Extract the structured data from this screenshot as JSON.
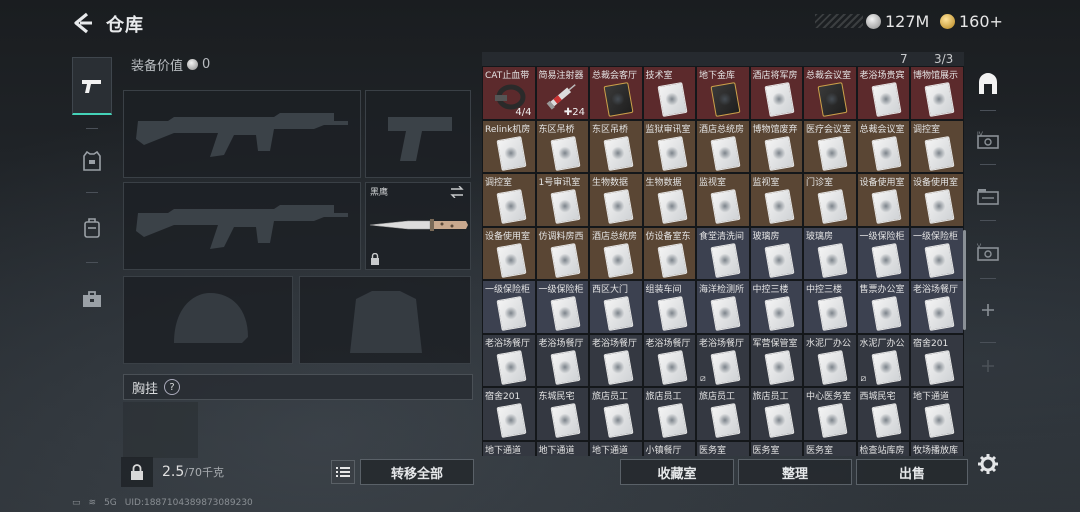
{
  "header": {
    "title": "仓库",
    "currency_silver": "127M",
    "currency_gold": "160+"
  },
  "equipment": {
    "value_label": "装备价值",
    "value": "0",
    "knife_label": "黑鹰",
    "chest_label": "胸挂",
    "chest_help": "?"
  },
  "footer": {
    "weight": "2.5",
    "weight_cap": "/70千克",
    "transfer_all": "转移全部",
    "collection_room": "收藏室",
    "organize": "整理",
    "sell": "出售"
  },
  "storage": {
    "header_counts": [
      "7",
      "3/3"
    ],
    "items": [
      {
        "name": "CAT止血带",
        "color": "r-red",
        "kind": "tourniquet",
        "stat": "4/4"
      },
      {
        "name": "简易注射器",
        "color": "r-red",
        "kind": "syringe",
        "stat": "✚24"
      },
      {
        "name": "总裁会客厅",
        "color": "r-red",
        "kind": "card-gold"
      },
      {
        "name": "技术室",
        "color": "r-red",
        "kind": "card"
      },
      {
        "name": "地下金库",
        "color": "r-red",
        "kind": "card-gold"
      },
      {
        "name": "酒店将军房",
        "color": "r-red",
        "kind": "card"
      },
      {
        "name": "总裁会议室",
        "color": "r-red",
        "kind": "card-gold"
      },
      {
        "name": "老浴场贵宾",
        "color": "r-red",
        "kind": "card"
      },
      {
        "name": "博物馆展示",
        "color": "r-red",
        "kind": "card"
      },
      {
        "name": "Relink机房",
        "color": "r-brown",
        "kind": "card"
      },
      {
        "name": "东区吊桥",
        "color": "r-brown",
        "kind": "card"
      },
      {
        "name": "东区吊桥",
        "color": "r-brown",
        "kind": "card"
      },
      {
        "name": "监狱审讯室",
        "color": "r-brown",
        "kind": "card"
      },
      {
        "name": "酒店总统房",
        "color": "r-brown",
        "kind": "card"
      },
      {
        "name": "博物馆废弃",
        "color": "r-brown",
        "kind": "card"
      },
      {
        "name": "医疗会议室",
        "color": "r-brown",
        "kind": "card"
      },
      {
        "name": "总裁会议室",
        "color": "r-brown",
        "kind": "card"
      },
      {
        "name": "调控室",
        "color": "r-brown",
        "kind": "card"
      },
      {
        "name": "调控室",
        "color": "r-brown",
        "kind": "card"
      },
      {
        "name": "1号审讯室",
        "color": "r-brown",
        "kind": "card"
      },
      {
        "name": "生物数据",
        "color": "r-brown",
        "kind": "card"
      },
      {
        "name": "生物数据",
        "color": "r-brown",
        "kind": "card"
      },
      {
        "name": "监视室",
        "color": "r-brown",
        "kind": "card"
      },
      {
        "name": "监视室",
        "color": "r-brown",
        "kind": "card"
      },
      {
        "name": "门诊室",
        "color": "r-brown",
        "kind": "card"
      },
      {
        "name": "设备使用室",
        "color": "r-brown",
        "kind": "card"
      },
      {
        "name": "设备使用室",
        "color": "r-brown",
        "kind": "card"
      },
      {
        "name": "设备使用室",
        "color": "r-brown",
        "kind": "card"
      },
      {
        "name": "仿调料房西",
        "color": "r-brown",
        "kind": "card"
      },
      {
        "name": "酒店总统房",
        "color": "r-brown",
        "kind": "card"
      },
      {
        "name": "仿设备室东",
        "color": "r-brown",
        "kind": "card"
      },
      {
        "name": "食堂清洗间",
        "color": "r-slate",
        "kind": "card"
      },
      {
        "name": "玻璃房",
        "color": "r-slate",
        "kind": "card"
      },
      {
        "name": "玻璃房",
        "color": "r-slate",
        "kind": "card"
      },
      {
        "name": "一级保险柜",
        "color": "r-slate",
        "kind": "card"
      },
      {
        "name": "一级保险柜",
        "color": "r-slate",
        "kind": "card"
      },
      {
        "name": "一级保险柜",
        "color": "r-slate",
        "kind": "card"
      },
      {
        "name": "一级保险柜",
        "color": "r-slate",
        "kind": "card"
      },
      {
        "name": "西区大门",
        "color": "r-slate",
        "kind": "card"
      },
      {
        "name": "组装车间",
        "color": "r-slate",
        "kind": "card"
      },
      {
        "name": "海洋检测所",
        "color": "r-slate",
        "kind": "card"
      },
      {
        "name": "中控三楼",
        "color": "r-slate",
        "kind": "card"
      },
      {
        "name": "中控三楼",
        "color": "r-slate",
        "kind": "card"
      },
      {
        "name": "售票办公室",
        "color": "r-slate",
        "kind": "card"
      },
      {
        "name": "老浴场餐厅",
        "color": "r-slate",
        "kind": "card"
      },
      {
        "name": "老浴场餐厅",
        "color": "r-dark",
        "kind": "card"
      },
      {
        "name": "老浴场餐厅",
        "color": "r-dark",
        "kind": "card"
      },
      {
        "name": "老浴场餐厅",
        "color": "r-dark",
        "kind": "card"
      },
      {
        "name": "老浴场餐厅",
        "color": "r-dark",
        "kind": "card"
      },
      {
        "name": "老浴场餐厅",
        "color": "r-dark",
        "kind": "card",
        "flag": "⧄"
      },
      {
        "name": "军营保管室",
        "color": "r-dark",
        "kind": "card"
      },
      {
        "name": "水泥厂办公",
        "color": "r-dark",
        "kind": "card"
      },
      {
        "name": "水泥厂办公",
        "color": "r-dark",
        "kind": "card",
        "flag": "⧄"
      },
      {
        "name": "宿舍201",
        "color": "r-dark",
        "kind": "card"
      },
      {
        "name": "宿舍201",
        "color": "r-dark",
        "kind": "card"
      },
      {
        "name": "东城民宅",
        "color": "r-dark",
        "kind": "card"
      },
      {
        "name": "旅店员工",
        "color": "r-dark",
        "kind": "card"
      },
      {
        "name": "旅店员工",
        "color": "r-dark",
        "kind": "card"
      },
      {
        "name": "旅店员工",
        "color": "r-dark",
        "kind": "card"
      },
      {
        "name": "旅店员工",
        "color": "r-dark",
        "kind": "card"
      },
      {
        "name": "中心医务室",
        "color": "r-dark",
        "kind": "card"
      },
      {
        "name": "西城民宅",
        "color": "r-dark",
        "kind": "card"
      },
      {
        "name": "地下通道",
        "color": "r-dark",
        "kind": "card"
      },
      {
        "name": "地下通道",
        "color": "r-dark",
        "kind": "card"
      },
      {
        "name": "地下通道",
        "color": "r-dark",
        "kind": "card"
      },
      {
        "name": "地下通道",
        "color": "r-dark",
        "kind": "card"
      },
      {
        "name": "小镇餐厅",
        "color": "r-dark",
        "kind": "card"
      },
      {
        "name": "医务室",
        "color": "r-dark",
        "kind": "card"
      },
      {
        "name": "医务室",
        "color": "r-dark",
        "kind": "card"
      },
      {
        "name": "医务室",
        "color": "r-dark",
        "kind": "card"
      },
      {
        "name": "检查站库房",
        "color": "r-dark",
        "kind": "card"
      },
      {
        "name": "牧场播放库",
        "color": "r-dark",
        "kind": "card"
      }
    ]
  },
  "statusbar": {
    "signal": "5G",
    "device_id": "UID:1887104389873089230"
  }
}
